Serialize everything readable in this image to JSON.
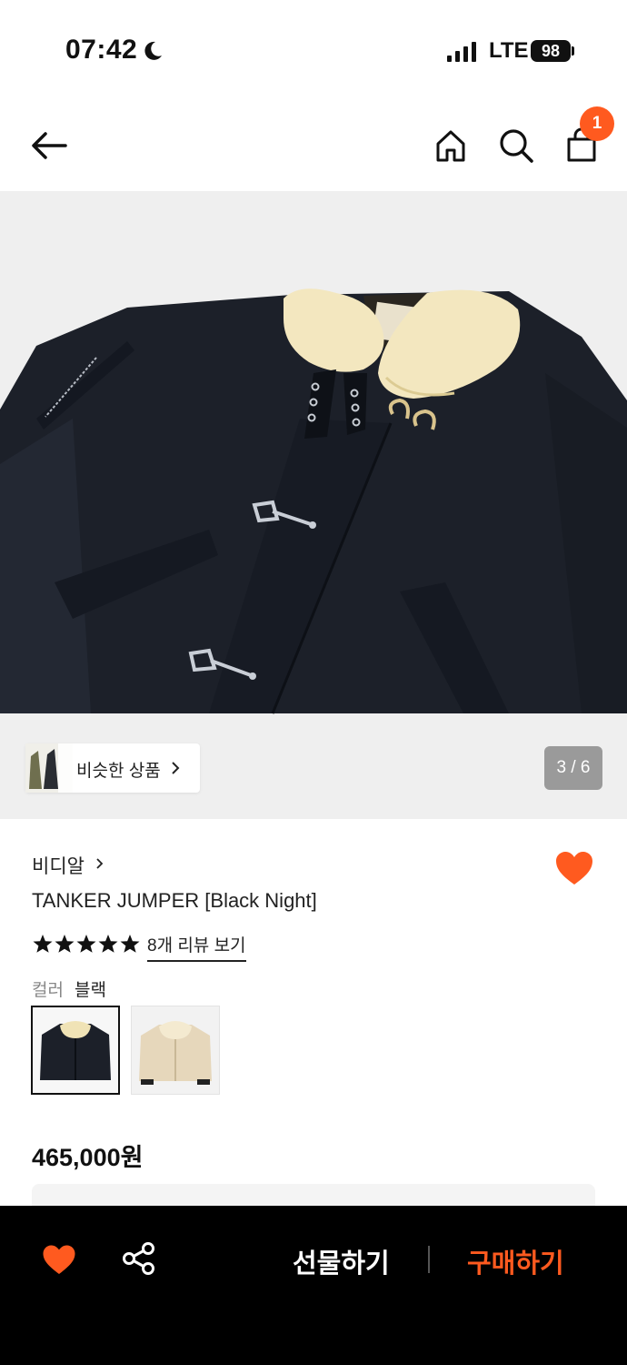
{
  "status_bar": {
    "time": "07:42",
    "network": "LTE",
    "battery": "98"
  },
  "header": {
    "cart_count": "1"
  },
  "gallery": {
    "similar_label": "비슷한 상품",
    "pager": "3 / 6"
  },
  "product": {
    "brand": "비디알",
    "title": "TANKER JUMPER [Black Night]",
    "rating": 5,
    "review_link": "8개 리뷰 보기",
    "color_label": "컬러",
    "color_value": "블랙",
    "price": "465,000원",
    "favorited": true
  },
  "bottom_bar": {
    "gift_label": "선물하기",
    "buy_label": "구매하기"
  },
  "colors": {
    "accent": "#ff5a1f",
    "bar": "#000000",
    "jacket": "#1c2029",
    "fleece": "#f3e7bf",
    "sand": "#e6d7bb"
  },
  "icons": [
    "moon-icon",
    "signal-icon",
    "back-arrow-icon",
    "home-icon",
    "search-icon",
    "shopping-bag-icon",
    "chevron-right-icon",
    "heart-icon",
    "star-icon",
    "share-icon"
  ]
}
